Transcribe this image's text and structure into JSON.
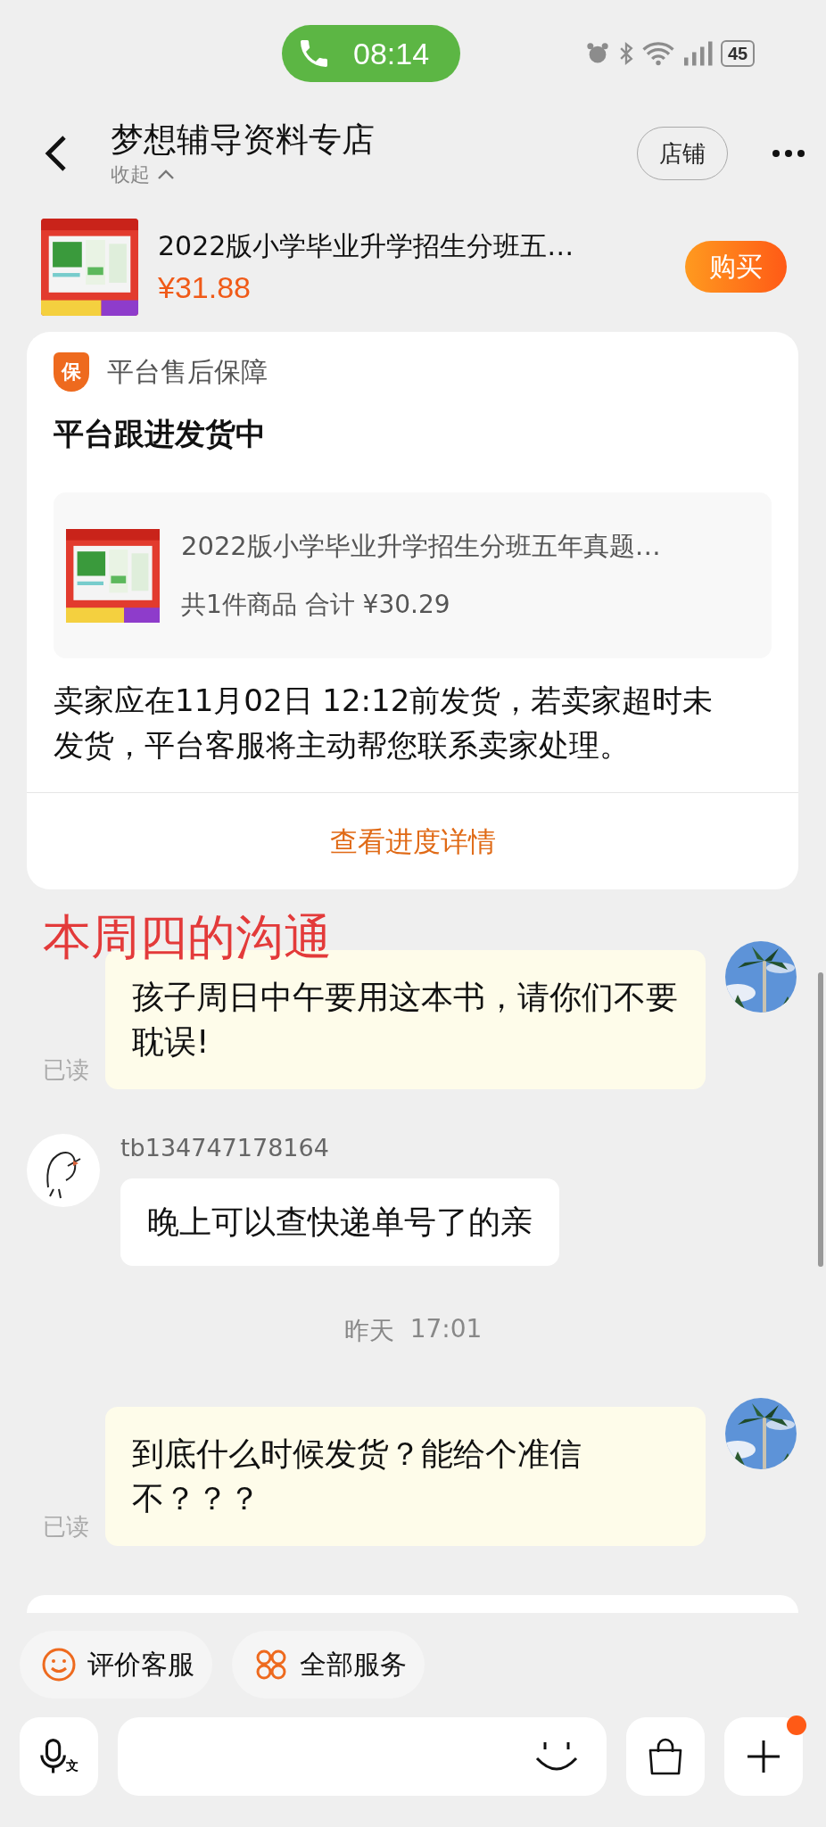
{
  "status_bar": {
    "call_time": "08:14",
    "battery": "45"
  },
  "header": {
    "title": "梦想辅导资料专店",
    "collapse": "收起",
    "shop_button": "店铺"
  },
  "product": {
    "title": "2022版小学毕业升学招生分班五…",
    "price": "¥31.88",
    "buy_button": "购买"
  },
  "card": {
    "badge": "保",
    "label": "平台售后保障",
    "heading": "平台跟进发货中",
    "item": {
      "title": "2022版小学毕业升学招生分班五年真题…",
      "summary": "共1件商品 合计 ¥30.29"
    },
    "notice": "卖家应在11月02日 12:12前发货，若卖家超时未发货，平台客服将主动帮您联系卖家处理。",
    "link": "查看进度详情"
  },
  "annotation": "本周四的沟通",
  "messages": [
    {
      "kind": "outgoing",
      "text": "孩子周日中午要用这本书，请你们不要耽误!",
      "read_receipt": "已读"
    },
    {
      "kind": "incoming",
      "sender": "tb134747178164",
      "text": "晚上可以查快递单号了的亲"
    },
    {
      "kind": "time",
      "day": "昨天",
      "time": "17:01"
    },
    {
      "kind": "outgoing",
      "text": "到底什么时候发货？能给个准信不？？？",
      "read_receipt": "已读"
    }
  ],
  "quick_actions": [
    {
      "kind": "smile",
      "label": "评价客服"
    },
    {
      "kind": "grid",
      "label": "全部服务"
    }
  ],
  "composer": {
    "voice_badge": "文",
    "notification": true
  }
}
